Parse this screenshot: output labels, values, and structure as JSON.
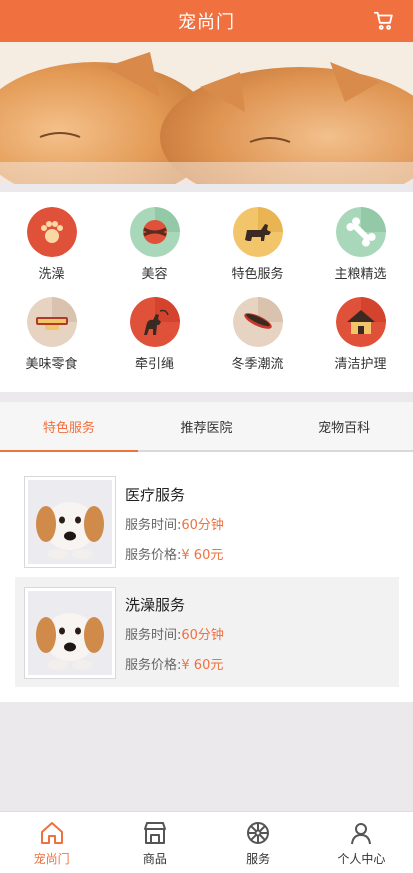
{
  "header": {
    "title": "宠尚门",
    "cart_icon": "cart-icon"
  },
  "banner": {
    "alt_icon": "kittens-photo"
  },
  "categories": [
    {
      "label": "洗澡",
      "icon": "paw-icon",
      "color": "#e0513a"
    },
    {
      "label": "美容",
      "icon": "ball-icon",
      "color": "#9fd3b0"
    },
    {
      "label": "特色服务",
      "icon": "dog-icon",
      "color": "#f2c56b"
    },
    {
      "label": "主粮精选",
      "icon": "bone-icon",
      "color": "#9fd3b0"
    },
    {
      "label": "美味零食",
      "icon": "treat-icon",
      "color": "#e7d3c2"
    },
    {
      "label": "牵引绳",
      "icon": "leash-icon",
      "color": "#e0513a"
    },
    {
      "label": "冬季潮流",
      "icon": "hat-icon",
      "color": "#e7d3c2"
    },
    {
      "label": "清洁护理",
      "icon": "house-icon",
      "color": "#e0513a"
    }
  ],
  "tabs": [
    {
      "label": "特色服务",
      "active": true
    },
    {
      "label": "推荐医院",
      "active": false
    },
    {
      "label": "宠物百科",
      "active": false
    }
  ],
  "services": [
    {
      "title": "医疗服务",
      "time_label": "服务时间:",
      "time_value": "60分钟",
      "price_label": "服务价格:",
      "price_value": "¥ 60元"
    },
    {
      "title": "洗澡服务",
      "time_label": "服务时间:",
      "time_value": "60分钟",
      "price_label": "服务价格:",
      "price_value": "¥ 60元"
    }
  ],
  "tabbar": [
    {
      "label": "宠尚门",
      "icon": "home-icon",
      "active": true
    },
    {
      "label": "商品",
      "icon": "shop-icon",
      "active": false
    },
    {
      "label": "服务",
      "icon": "wheel-icon",
      "active": false
    },
    {
      "label": "个人中心",
      "icon": "user-icon",
      "active": false
    }
  ],
  "colors": {
    "accent": "#f0703f",
    "background": "#ebe9ec"
  }
}
